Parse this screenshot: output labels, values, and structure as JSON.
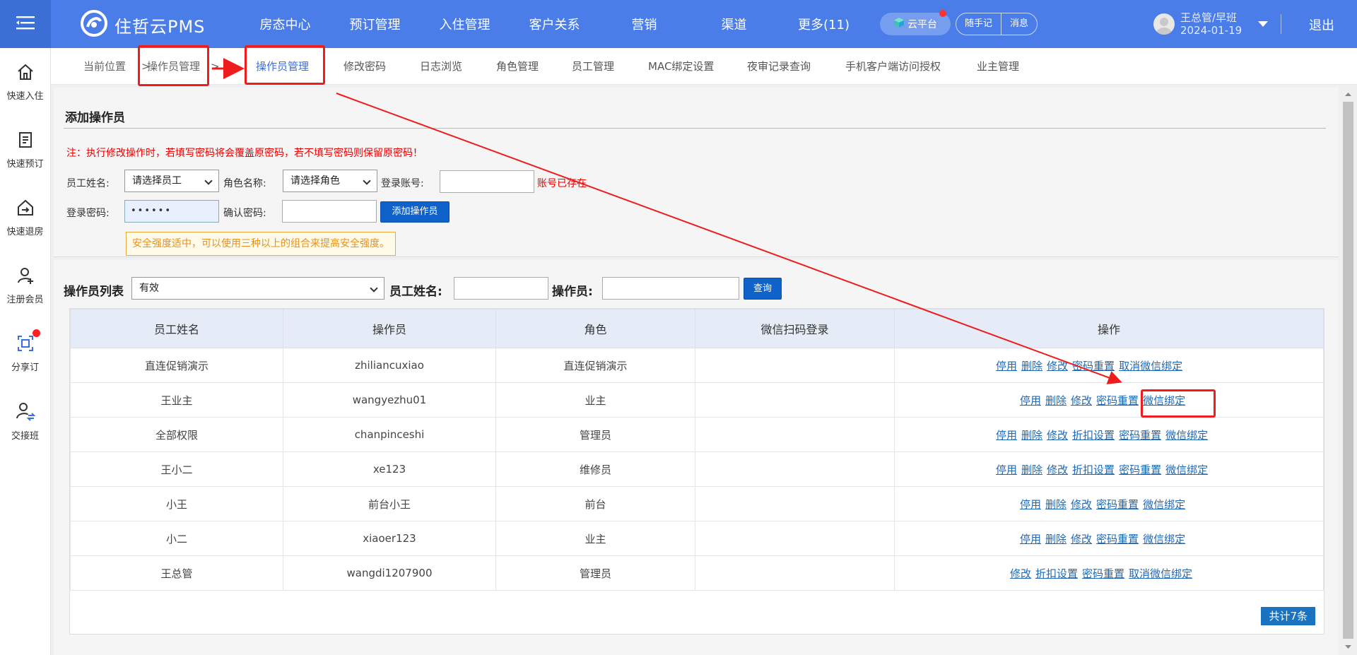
{
  "app": {
    "title": "住哲云PMS"
  },
  "nav": [
    "房态中心",
    "预订管理",
    "入住管理",
    "客户关系",
    "营销",
    "渠道",
    "更多(11)"
  ],
  "header": {
    "cloud_label": "云平台",
    "note_label": "随手记",
    "message_label": "消息",
    "user_name": "王总管/早班",
    "date": "2024-01-19",
    "logout": "退出"
  },
  "sidebar": [
    {
      "label": "快速入住",
      "icon": "home-icon"
    },
    {
      "label": "快速预订",
      "icon": "booking-icon"
    },
    {
      "label": "快速退房",
      "icon": "checkout-icon"
    },
    {
      "label": "注册会员",
      "icon": "add-member-icon"
    },
    {
      "label": "分享订",
      "icon": "share-order-icon"
    },
    {
      "label": "交接班",
      "icon": "shift-handover-icon"
    }
  ],
  "breadcrumb": {
    "prefix": "当前位置",
    "parent": "操作员管理",
    "sep": ">"
  },
  "tabs": [
    "操作员管理",
    "修改密码",
    "日志浏览",
    "角色管理",
    "员工管理",
    "MAC绑定设置",
    "夜审记录查询",
    "手机客户端访问授权",
    "业主管理"
  ],
  "add_form": {
    "title": "添加操作员",
    "warning": "注：执行修改操作时，若填写密码将会覆盖原密码，若不填写密码则保留原密码！",
    "employee_label": "员工姓名:",
    "employee_value": "请选择员工",
    "role_label": "角色名称:",
    "role_value": "请选择角色",
    "account_label": "登录账号:",
    "account_error": "账号已存在",
    "password_label": "登录密码:",
    "password_value": "••••••",
    "confirm_label": "确认密码:",
    "add_button": "添加操作员",
    "tip": "安全强度适中，可以使用三种以上的组合来提高安全强度。"
  },
  "list": {
    "title": "操作员列表",
    "status_value": "有效",
    "employee_label": "员工姓名:",
    "operator_label": "操作员:",
    "query_button": "查询",
    "columns": [
      "员工姓名",
      "操作员",
      "角色",
      "微信扫码登录",
      "操作"
    ],
    "rows": [
      {
        "name": "直连促销演示",
        "operator": "zhiliancuxiao",
        "role": "直连促销演示",
        "wechat": "",
        "actions": [
          "停用",
          "删除",
          "修改",
          "密码重置",
          "取消微信绑定"
        ]
      },
      {
        "name": "王业主",
        "operator": "wangyezhu01",
        "role": "业主",
        "wechat": "",
        "actions": [
          "停用",
          "删除",
          "修改",
          "密码重置",
          "微信绑定"
        ]
      },
      {
        "name": "全部权限",
        "operator": "chanpinceshi",
        "role": "管理员",
        "wechat": "",
        "actions": [
          "停用",
          "删除",
          "修改",
          "折扣设置",
          "密码重置",
          "微信绑定"
        ]
      },
      {
        "name": "王小二",
        "operator": "xe123",
        "role": "维修员",
        "wechat": "",
        "actions": [
          "停用",
          "删除",
          "修改",
          "折扣设置",
          "密码重置",
          "微信绑定"
        ]
      },
      {
        "name": "小王",
        "operator": "前台小王",
        "role": "前台",
        "wechat": "",
        "actions": [
          "停用",
          "删除",
          "修改",
          "密码重置",
          "微信绑定"
        ]
      },
      {
        "name": "小二",
        "operator": "xiaoer123",
        "role": "业主",
        "wechat": "",
        "actions": [
          "停用",
          "删除",
          "修改",
          "密码重置",
          "微信绑定"
        ]
      },
      {
        "name": "王总管",
        "operator": "wangdi1207900",
        "role": "管理员",
        "wechat": "",
        "actions": [
          "修改",
          "折扣设置",
          "密码重置",
          "取消微信绑定"
        ]
      }
    ],
    "total": "共计7条"
  },
  "colors": {
    "topbar": "#4a7de8",
    "accent": "#3b6ee0",
    "annotation_red": "#ee1c1c",
    "link": "#1f68b5"
  }
}
